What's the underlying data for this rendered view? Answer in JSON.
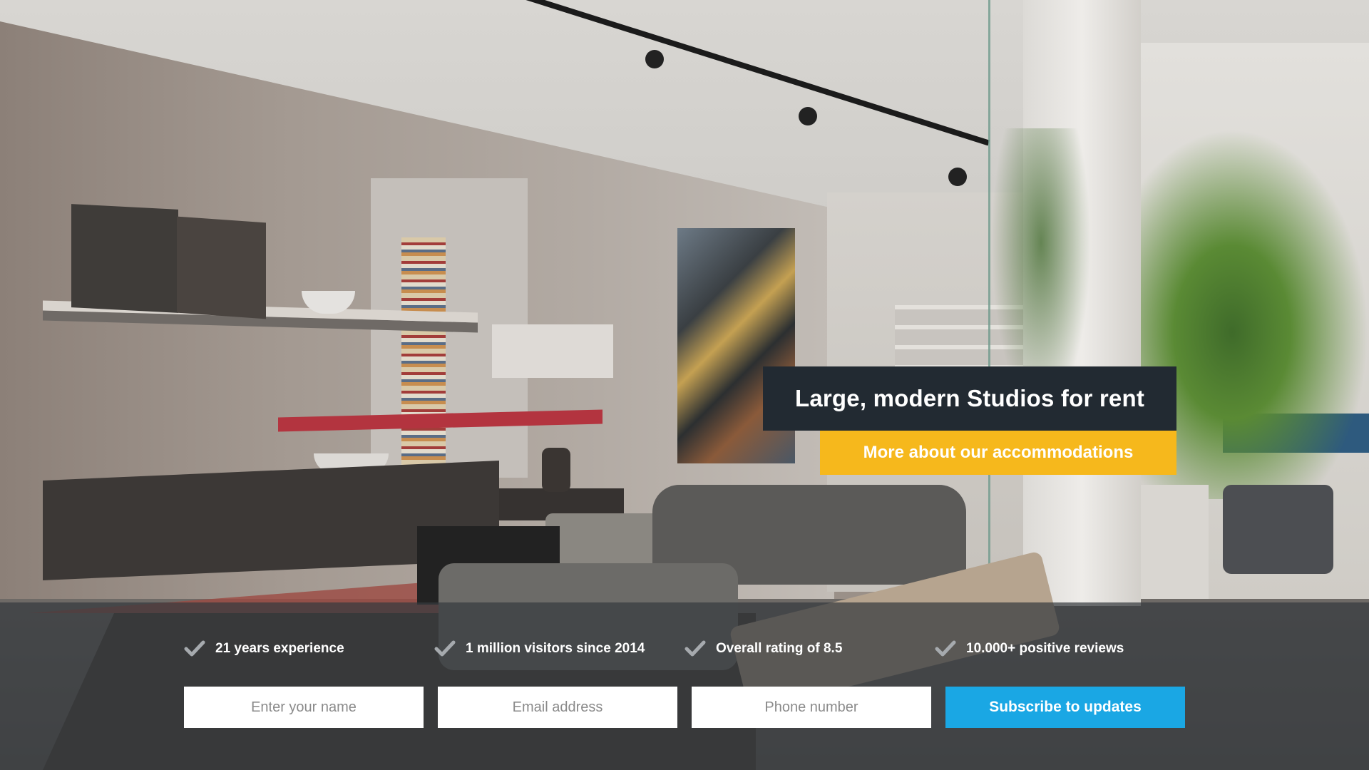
{
  "hero": {
    "title": "Large, modern Studios for rent",
    "cta_label": "More about our accommodations",
    "title_bg": "#222a32",
    "cta_bg": "#f6b81c"
  },
  "features": [
    {
      "icon": "check-icon",
      "label": "21 years experience"
    },
    {
      "icon": "check-icon",
      "label": "1 million visitors since 2014"
    },
    {
      "icon": "check-icon",
      "label": "Overall rating of 8.5"
    },
    {
      "icon": "check-icon",
      "label": "10.000+ positive reviews"
    }
  ],
  "form": {
    "name_placeholder": "Enter your name",
    "email_placeholder": "Email address",
    "phone_placeholder": "Phone number",
    "subscribe_label": "Subscribe to updates",
    "subscribe_bg": "#1aa7e4"
  }
}
